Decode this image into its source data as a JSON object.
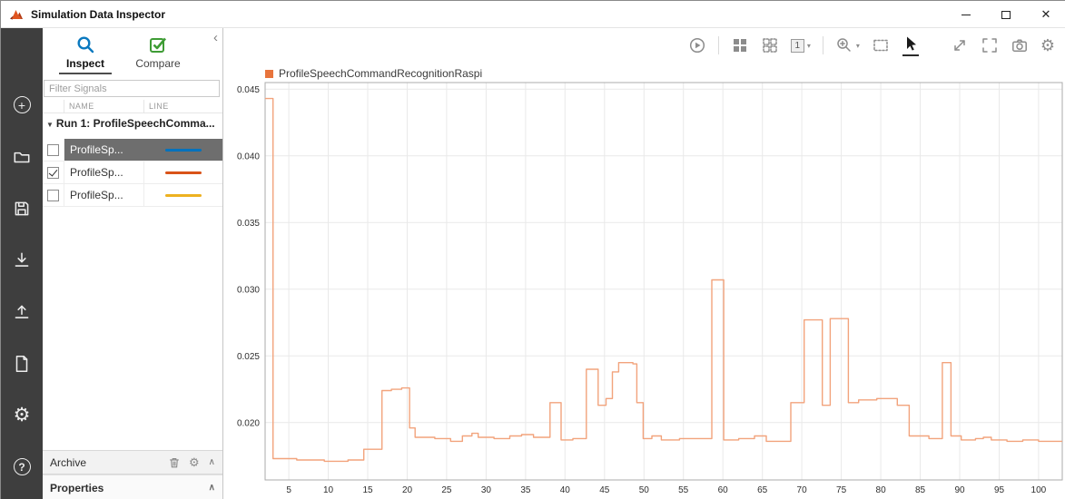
{
  "window": {
    "title": "Simulation Data Inspector"
  },
  "icons": {
    "close": "✕",
    "chevron_collapse": "‹",
    "caret_down": "▾",
    "run_caret": "▼",
    "chevron_up": "∧",
    "gear": "⚙",
    "question": "?",
    "plus": "+"
  },
  "panel": {
    "tabs": [
      {
        "label": "Inspect",
        "selected": true
      },
      {
        "label": "Compare",
        "selected": false
      }
    ],
    "filter_placeholder": "Filter Signals",
    "columns": {
      "name": "NAME",
      "line": "LINE"
    },
    "run": {
      "label": "Run 1: ProfileSpeechComma..."
    },
    "signals": [
      {
        "name": "ProfileSp...",
        "checked": false,
        "selected": true,
        "color": "#0072bd"
      },
      {
        "name": "ProfileSp...",
        "checked": true,
        "selected": false,
        "color": "#d95319"
      },
      {
        "name": "ProfileSp...",
        "checked": false,
        "selected": false,
        "color": "#edb120"
      }
    ],
    "archive": {
      "label": "Archive"
    },
    "properties": {
      "label": "Properties"
    }
  },
  "toolbar": {
    "view_count": "1"
  },
  "legend": {
    "label": "ProfileSpeechCommandRecognitionRaspi",
    "color": "#e8743c"
  },
  "chart_data": {
    "type": "line",
    "mode": "stairs",
    "title": "",
    "xlabel": "",
    "ylabel": "",
    "xlim": [
      2,
      103
    ],
    "ylim": [
      0.0157,
      0.0455
    ],
    "xticks": [
      5,
      10,
      15,
      20,
      25,
      30,
      35,
      40,
      45,
      50,
      55,
      60,
      65,
      70,
      75,
      80,
      85,
      90,
      95,
      100
    ],
    "yticks": [
      0.02,
      0.025,
      0.03,
      0.035,
      0.04,
      0.045
    ],
    "ytick_labels": [
      "0.020",
      "0.025",
      "0.030",
      "0.035",
      "0.040",
      "0.045"
    ],
    "grid": true,
    "legend_position": "top-left",
    "series": [
      {
        "name": "ProfileSpeechCommandRecognitionRaspi",
        "color": "#f2a37c",
        "step_points": [
          [
            2,
            0.0443
          ],
          [
            3,
            0.0173
          ],
          [
            6,
            0.0172
          ],
          [
            9.5,
            0.0171
          ],
          [
            12.5,
            0.0172
          ],
          [
            14.5,
            0.018
          ],
          [
            16.8,
            0.0224
          ],
          [
            18,
            0.0225
          ],
          [
            19.3,
            0.0226
          ],
          [
            20.3,
            0.0196
          ],
          [
            21,
            0.0189
          ],
          [
            23.5,
            0.0188
          ],
          [
            25.5,
            0.0186
          ],
          [
            27,
            0.019
          ],
          [
            28.2,
            0.0192
          ],
          [
            29,
            0.0189
          ],
          [
            31,
            0.0188
          ],
          [
            33,
            0.019
          ],
          [
            34.5,
            0.0191
          ],
          [
            36,
            0.0189
          ],
          [
            38.1,
            0.0215
          ],
          [
            39.5,
            0.0187
          ],
          [
            41,
            0.0188
          ],
          [
            42.7,
            0.024
          ],
          [
            44.2,
            0.0213
          ],
          [
            45.2,
            0.0218
          ],
          [
            46,
            0.0238
          ],
          [
            46.8,
            0.0245
          ],
          [
            48.6,
            0.0244
          ],
          [
            49.1,
            0.0215
          ],
          [
            49.9,
            0.0188
          ],
          [
            51,
            0.019
          ],
          [
            52.2,
            0.0187
          ],
          [
            54.5,
            0.0188
          ],
          [
            58.6,
            0.0307
          ],
          [
            60.1,
            0.0187
          ],
          [
            62,
            0.0188
          ],
          [
            64,
            0.019
          ],
          [
            65.5,
            0.0186
          ],
          [
            68.6,
            0.0215
          ],
          [
            70.3,
            0.0277
          ],
          [
            72.6,
            0.0213
          ],
          [
            73.6,
            0.0278
          ],
          [
            75.9,
            0.0215
          ],
          [
            77.2,
            0.0217
          ],
          [
            79.5,
            0.0218
          ],
          [
            82.1,
            0.0213
          ],
          [
            83.6,
            0.019
          ],
          [
            86.1,
            0.0188
          ],
          [
            87.8,
            0.0245
          ],
          [
            88.9,
            0.019
          ],
          [
            90.2,
            0.0187
          ],
          [
            92,
            0.0188
          ],
          [
            93,
            0.0189
          ],
          [
            94,
            0.0187
          ],
          [
            96,
            0.0186
          ],
          [
            98,
            0.0187
          ],
          [
            100,
            0.0186
          ],
          [
            103,
            0.0186
          ]
        ]
      }
    ]
  }
}
